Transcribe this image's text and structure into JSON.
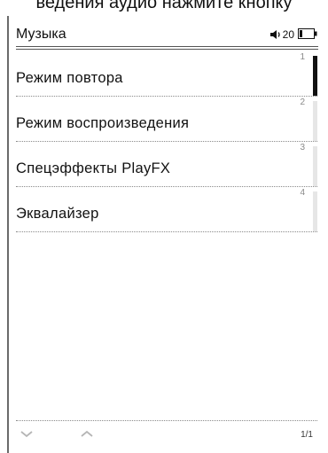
{
  "caption": "ведения аудио нажмите кнопку",
  "status": {
    "title": "Музыка",
    "volume": "20",
    "icons": [
      "speaker-icon",
      "battery-icon"
    ]
  },
  "menu": {
    "items": [
      {
        "label": "Режим повтора",
        "index": "1",
        "active": true
      },
      {
        "label": "Режим воспроизведения",
        "index": "2",
        "active": false
      },
      {
        "label": "Спецэффекты PlayFX",
        "index": "3",
        "active": false
      },
      {
        "label": "Эквалайзер",
        "index": "4",
        "active": false
      }
    ]
  },
  "footer": {
    "page": "1/1",
    "icons": [
      "chevron-down-icon",
      "chevron-up-icon"
    ]
  },
  "colors": {
    "active_scroll": "#111111",
    "inactive_scroll": "#e6e6e6",
    "text": "#111111"
  }
}
